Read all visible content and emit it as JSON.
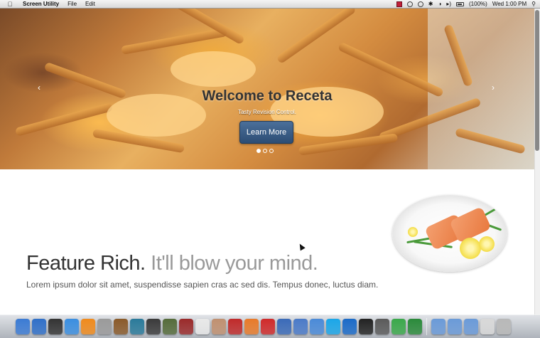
{
  "menubar": {
    "app_name": "Screen Utility",
    "menus": [
      "File",
      "Edit"
    ],
    "battery": "(100%)",
    "clock": "Wed 1:00 PM"
  },
  "hero": {
    "title": "Welcome to Receta",
    "subtitle": "Tasty Revision Control.",
    "button_label": "Learn More",
    "prev_arrow": "‹",
    "next_arrow": "›",
    "slides": 3,
    "active_slide": 1
  },
  "feature": {
    "headline": "Feature Rich.",
    "headline_muted": "It'll blow your mind.",
    "body": "Lorem ipsum dolor sit amet, suspendisse sapien cras ac sed dis. Tempus donec, luctus diam."
  },
  "dock": {
    "icons": [
      {
        "name": "finder-icon",
        "color": "#3b7bd4"
      },
      {
        "name": "app-store-icon",
        "color": "#2f6fc8"
      },
      {
        "name": "dashboard-icon",
        "color": "#333333"
      },
      {
        "name": "safari-icon",
        "color": "#3a8ee0"
      },
      {
        "name": "vlc-icon",
        "color": "#f08a1c"
      },
      {
        "name": "preview-icon",
        "color": "#9a9a9a"
      },
      {
        "name": "garageband-icon",
        "color": "#8a5a2a"
      },
      {
        "name": "time-machine-icon",
        "color": "#2a7a9a"
      },
      {
        "name": "photo-booth-icon",
        "color": "#3a3a3a"
      },
      {
        "name": "chess-icon",
        "color": "#556b3a"
      },
      {
        "name": "dictionary-icon",
        "color": "#9a2a2a"
      },
      {
        "name": "calendar-icon",
        "color": "#e8e8e8"
      },
      {
        "name": "notes-icon",
        "color": "#c09070"
      },
      {
        "name": "scissors-icon",
        "color": "#c02a2a"
      },
      {
        "name": "sublime-icon",
        "color": "#e87a2a"
      },
      {
        "name": "gear-icon",
        "color": "#d02a2a"
      },
      {
        "name": "xcode-icon",
        "color": "#3a6ab8"
      },
      {
        "name": "pen-icon",
        "color": "#4a7ac8"
      },
      {
        "name": "folder-icon",
        "color": "#4a8ad8"
      },
      {
        "name": "skype-icon",
        "color": "#1aa6e8"
      },
      {
        "name": "teamviewer-icon",
        "color": "#1a6ac8"
      },
      {
        "name": "terminal-icon",
        "color": "#222222"
      },
      {
        "name": "console-icon",
        "color": "#5a5a5a"
      },
      {
        "name": "chrome-icon",
        "color": "#3aa84a"
      },
      {
        "name": "color-picker-icon",
        "color": "#2a8a3a"
      },
      {
        "name": "applications-folder-icon",
        "color": "#6a9ad8"
      },
      {
        "name": "documents-folder-icon",
        "color": "#6a9ad8"
      },
      {
        "name": "downloads-folder-icon",
        "color": "#6a9ad8"
      },
      {
        "name": "stack-icon",
        "color": "#d8d8d8"
      },
      {
        "name": "trash-icon",
        "color": "#b8b8b8"
      }
    ]
  }
}
